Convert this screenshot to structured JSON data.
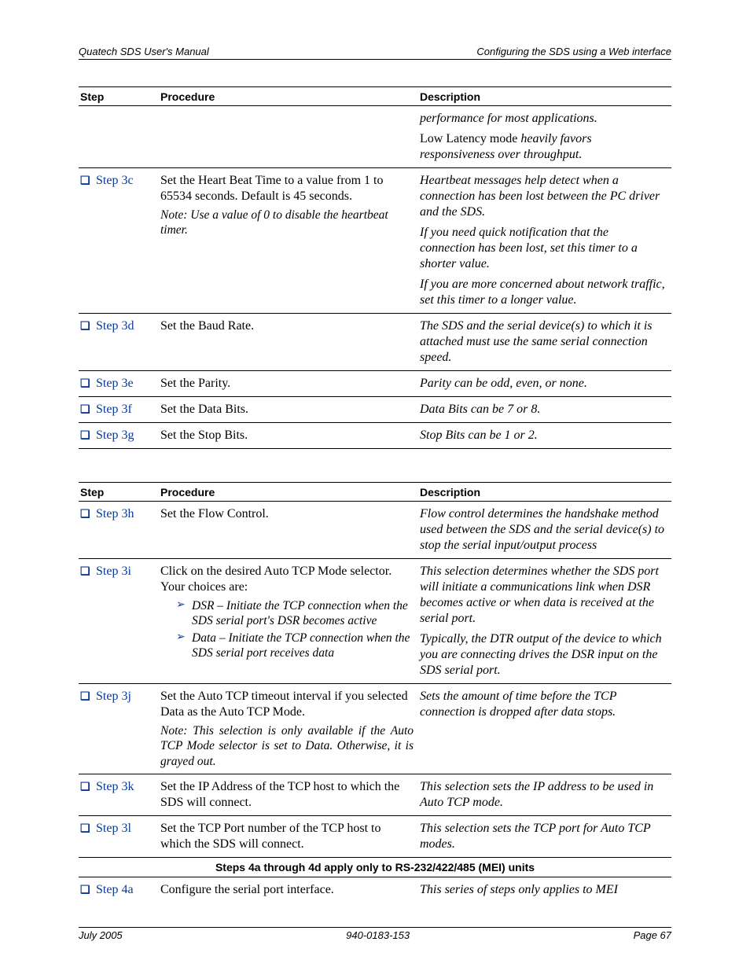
{
  "header": {
    "left": "Quatech SDS User's Manual",
    "right": "Configuring the SDS using a Web interface"
  },
  "table1": {
    "head": {
      "step": "Step",
      "proc": "Procedure",
      "desc": "Description"
    },
    "row_cont": {
      "d1": "performance for most applications.",
      "d2a": "Low Latency mode ",
      "d2b": "heavily favors responsiveness over throughput."
    },
    "r3c": {
      "label": "Step 3c",
      "proc": "Set the Heart Beat Time to a value from 1 to 65534 seconds. Default is 45 seconds.",
      "note": "Note: Use a value of 0 to disable the heartbeat timer.",
      "d1": "Heartbeat messages help detect when a connection has been lost between the PC driver and the SDS.",
      "d2": "If you need quick notification that the connection has been lost, set this timer to a shorter value.",
      "d3": "If you are more concerned about network traffic, set this timer to a longer value."
    },
    "r3d": {
      "label": "Step 3d",
      "proc": "Set the Baud Rate.",
      "desc": "The SDS and the serial device(s) to which it is attached must use the same serial connection speed."
    },
    "r3e": {
      "label": "Step 3e",
      "proc": "Set the Parity.",
      "desc": "Parity can be odd, even, or none."
    },
    "r3f": {
      "label": "Step 3f",
      "proc": "Set the Data Bits.",
      "desc": "Data Bits can be 7 or 8."
    },
    "r3g": {
      "label": "Step 3g",
      "proc": "Set the Stop Bits.",
      "desc": "Stop Bits can be 1 or 2."
    }
  },
  "table2": {
    "head": {
      "step": "Step",
      "proc": "Procedure",
      "desc": "Description"
    },
    "r3h": {
      "label": "Step 3h",
      "proc": "Set the Flow Control.",
      "desc": "Flow control determines the handshake method used between the SDS and the serial device(s) to stop the serial input/output process"
    },
    "r3i": {
      "label": "Step 3i",
      "p_line1": "Click on the desired Auto TCP Mode selector.",
      "p_line2": "Your choices are:",
      "opt1": "DSR – Initiate the TCP connection when the SDS serial port's DSR becomes active",
      "opt2": "Data – Initiate the TCP connection when the SDS serial port receives data",
      "d1": "This selection determines whether the SDS port will initiate a communications link when DSR becomes active or when data is received at the serial port.",
      "d2": "Typically, the DTR output of the device to which you are connecting drives the DSR input on the SDS serial port."
    },
    "r3j": {
      "label": "Step 3j",
      "proc": "Set the Auto TCP timeout interval if you selected Data as the Auto TCP Mode.",
      "note": "Note: This selection is only available if the Auto TCP Mode selector is set to Data. Otherwise, it is grayed out.",
      "desc": "Sets the amount of time before the TCP connection is dropped after data stops."
    },
    "r3k": {
      "label": "Step 3k",
      "proc": "Set the IP Address of the TCP host to which the SDS will connect.",
      "desc": "This selection sets the IP address to be used in Auto TCP mode."
    },
    "r3l": {
      "label": "Step 3l",
      "proc": "Set the TCP Port number of the TCP host to which the SDS will connect.",
      "desc": "This selection sets the TCP port for Auto TCP modes."
    },
    "section": "Steps 4a through 4d apply only to RS-232/422/485 (MEI) units",
    "r4a": {
      "label": "Step 4a",
      "proc": "Configure the serial port interface.",
      "desc": "This series of steps only applies to MEI"
    }
  },
  "footer": {
    "left": "July 2005",
    "center": "940-0183-153",
    "right": "Page 67"
  }
}
